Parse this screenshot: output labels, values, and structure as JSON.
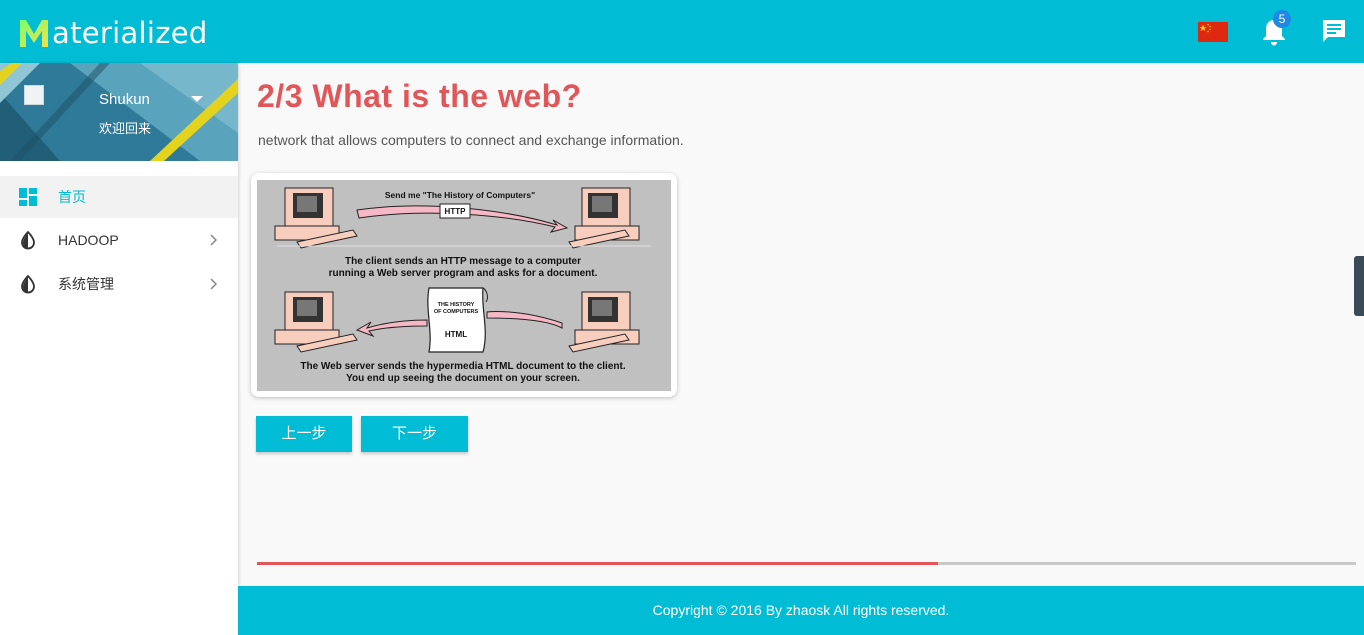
{
  "app": {
    "title": "Materialized",
    "logo_letter": "M",
    "logo_rest": "aterialized"
  },
  "header": {
    "notification_count": "5",
    "icons": [
      "china-flag-icon",
      "bell-icon",
      "chat-icon"
    ]
  },
  "sidebar": {
    "user": {
      "name": "Shukun",
      "welcome": "欢迎回来"
    },
    "items": [
      {
        "label": "首页",
        "icon": "dashboard-icon",
        "active": true
      },
      {
        "label": "HADOOP",
        "icon": "invert-colors-icon",
        "has_submenu": true
      },
      {
        "label": "系统管理",
        "icon": "invert-colors-icon",
        "has_submenu": true
      }
    ]
  },
  "main": {
    "title": "2/3 What is the web?",
    "description": "network that allows computers to connect and exchange information.",
    "figure": {
      "top_caption": "Send me \"The History of Computers\"",
      "http_label": "HTTP",
      "middle_line1": "The client sends an HTTP message to a computer",
      "middle_line2": "running a Web server program and asks for a document.",
      "doc_line1": "THE HISTORY",
      "doc_line2": "OF COMPUTERS",
      "doc_label": "HTML",
      "bottom_line1": "The Web server sends the hypermedia HTML document to the client.",
      "bottom_line2": "You end up seeing the document on your screen."
    },
    "buttons": {
      "prev": "上一步",
      "next": "下一步"
    },
    "progress": {
      "value": 0.62
    }
  },
  "footer": {
    "copyright": "Copyright © 2016 By zhaosk All rights reserved."
  },
  "colors": {
    "primary": "#00bcd4",
    "accent": "#e15759"
  }
}
